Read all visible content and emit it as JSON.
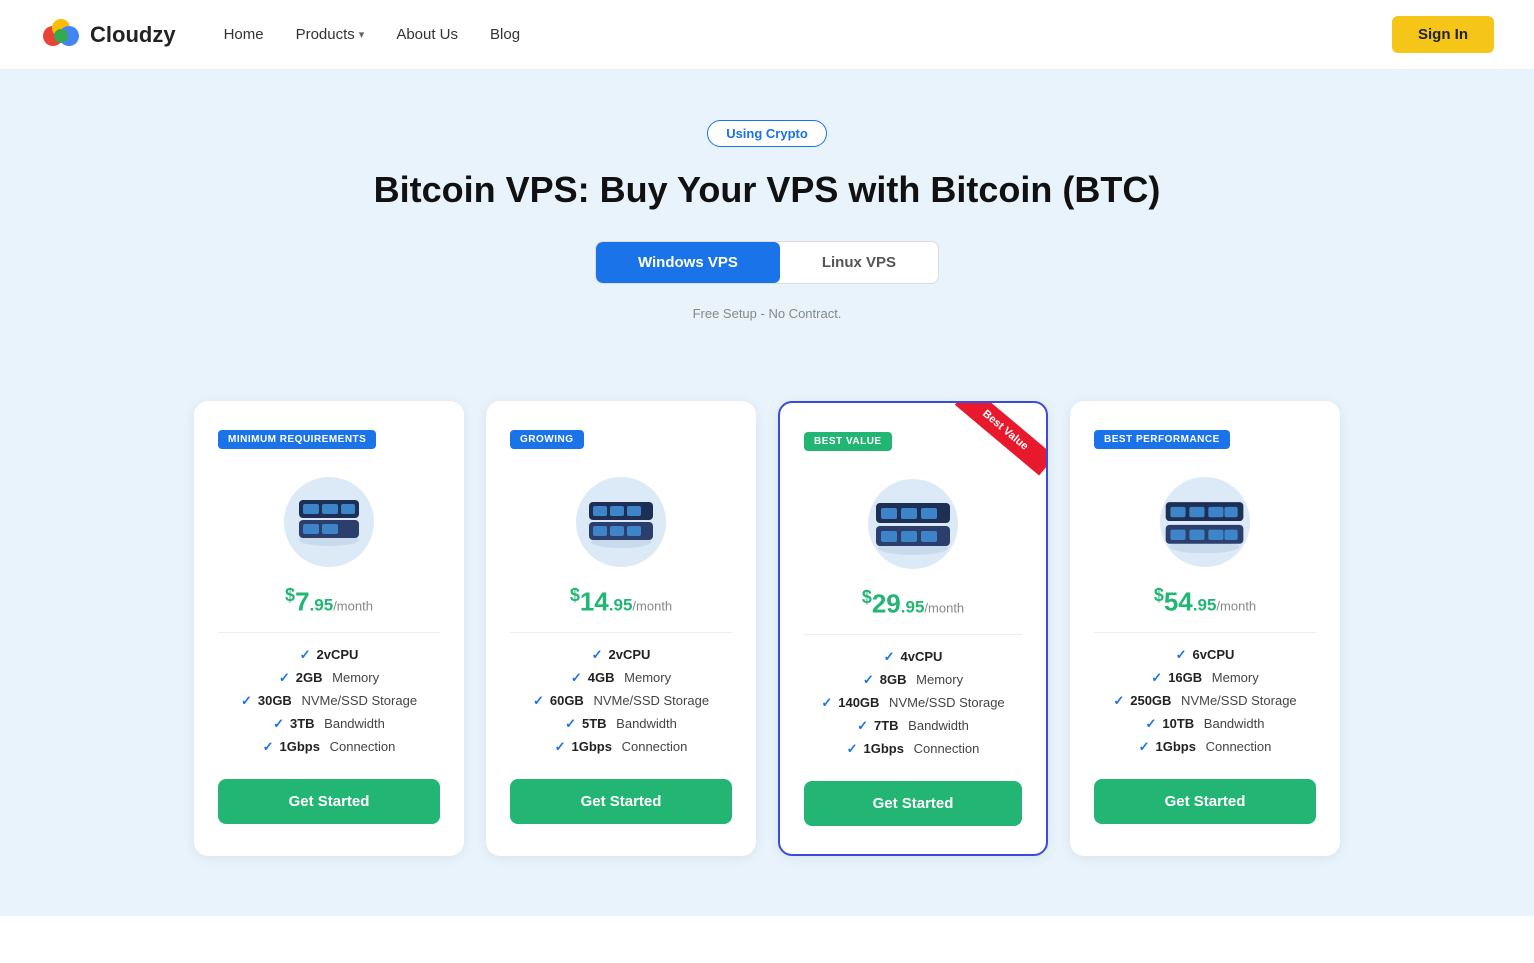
{
  "navbar": {
    "logo_text": "Cloudzy",
    "links": [
      {
        "label": "Home",
        "has_dropdown": false
      },
      {
        "label": "Products",
        "has_dropdown": true
      },
      {
        "label": "About Us",
        "has_dropdown": false
      },
      {
        "label": "Blog",
        "has_dropdown": false
      }
    ],
    "signin_label": "Sign In"
  },
  "hero": {
    "badge": "Using Crypto",
    "title": "Bitcoin VPS: Buy Your VPS with Bitcoin (BTC)",
    "toggle": {
      "windows_label": "Windows VPS",
      "linux_label": "Linux VPS"
    },
    "subtitle": "Free Setup - No Contract."
  },
  "pricing": {
    "cards": [
      {
        "badge": "MINIMUM REQUIREMENTS",
        "badge_color": "blue",
        "price_main": "7",
        "price_cents": "95",
        "price_period": "/month",
        "best_value": false,
        "features": [
          {
            "value": "2vCPU",
            "bold": "2vCPU",
            "rest": ""
          },
          {
            "bold": "2GB",
            "rest": " Memory"
          },
          {
            "bold": "30GB",
            "rest": " NVMe/SSD Storage"
          },
          {
            "bold": "3TB",
            "rest": " Bandwidth"
          },
          {
            "bold": "1Gbps",
            "rest": " Connection"
          }
        ],
        "cta": "Get Started"
      },
      {
        "badge": "GROWING",
        "badge_color": "blue",
        "price_main": "14",
        "price_cents": "95",
        "price_period": "/month",
        "best_value": false,
        "features": [
          {
            "bold": "2vCPU",
            "rest": ""
          },
          {
            "bold": "4GB",
            "rest": " Memory"
          },
          {
            "bold": "60GB",
            "rest": " NVMe/SSD Storage"
          },
          {
            "bold": "5TB",
            "rest": " Bandwidth"
          },
          {
            "bold": "1Gbps",
            "rest": " Connection"
          }
        ],
        "cta": "Get Started"
      },
      {
        "badge": "BEST VALUE",
        "badge_color": "green",
        "price_main": "29",
        "price_cents": "95",
        "price_period": "/month",
        "best_value": true,
        "ribbon": "Best Value",
        "features": [
          {
            "bold": "4vCPU",
            "rest": ""
          },
          {
            "bold": "8GB",
            "rest": " Memory"
          },
          {
            "bold": "140GB",
            "rest": " NVMe/SSD Storage"
          },
          {
            "bold": "7TB",
            "rest": " Bandwidth"
          },
          {
            "bold": "1Gbps",
            "rest": " Connection"
          }
        ],
        "cta": "Get Started"
      },
      {
        "badge": "BEST PERFORMANCE",
        "badge_color": "blue",
        "price_main": "54",
        "price_cents": "95",
        "price_period": "/month",
        "best_value": false,
        "features": [
          {
            "bold": "6vCPU",
            "rest": ""
          },
          {
            "bold": "16GB",
            "rest": " Memory"
          },
          {
            "bold": "250GB",
            "rest": " NVMe/SSD Storage"
          },
          {
            "bold": "10TB",
            "rest": " Bandwidth"
          },
          {
            "bold": "1Gbps",
            "rest": " Connection"
          }
        ],
        "cta": "Get Started"
      }
    ]
  }
}
